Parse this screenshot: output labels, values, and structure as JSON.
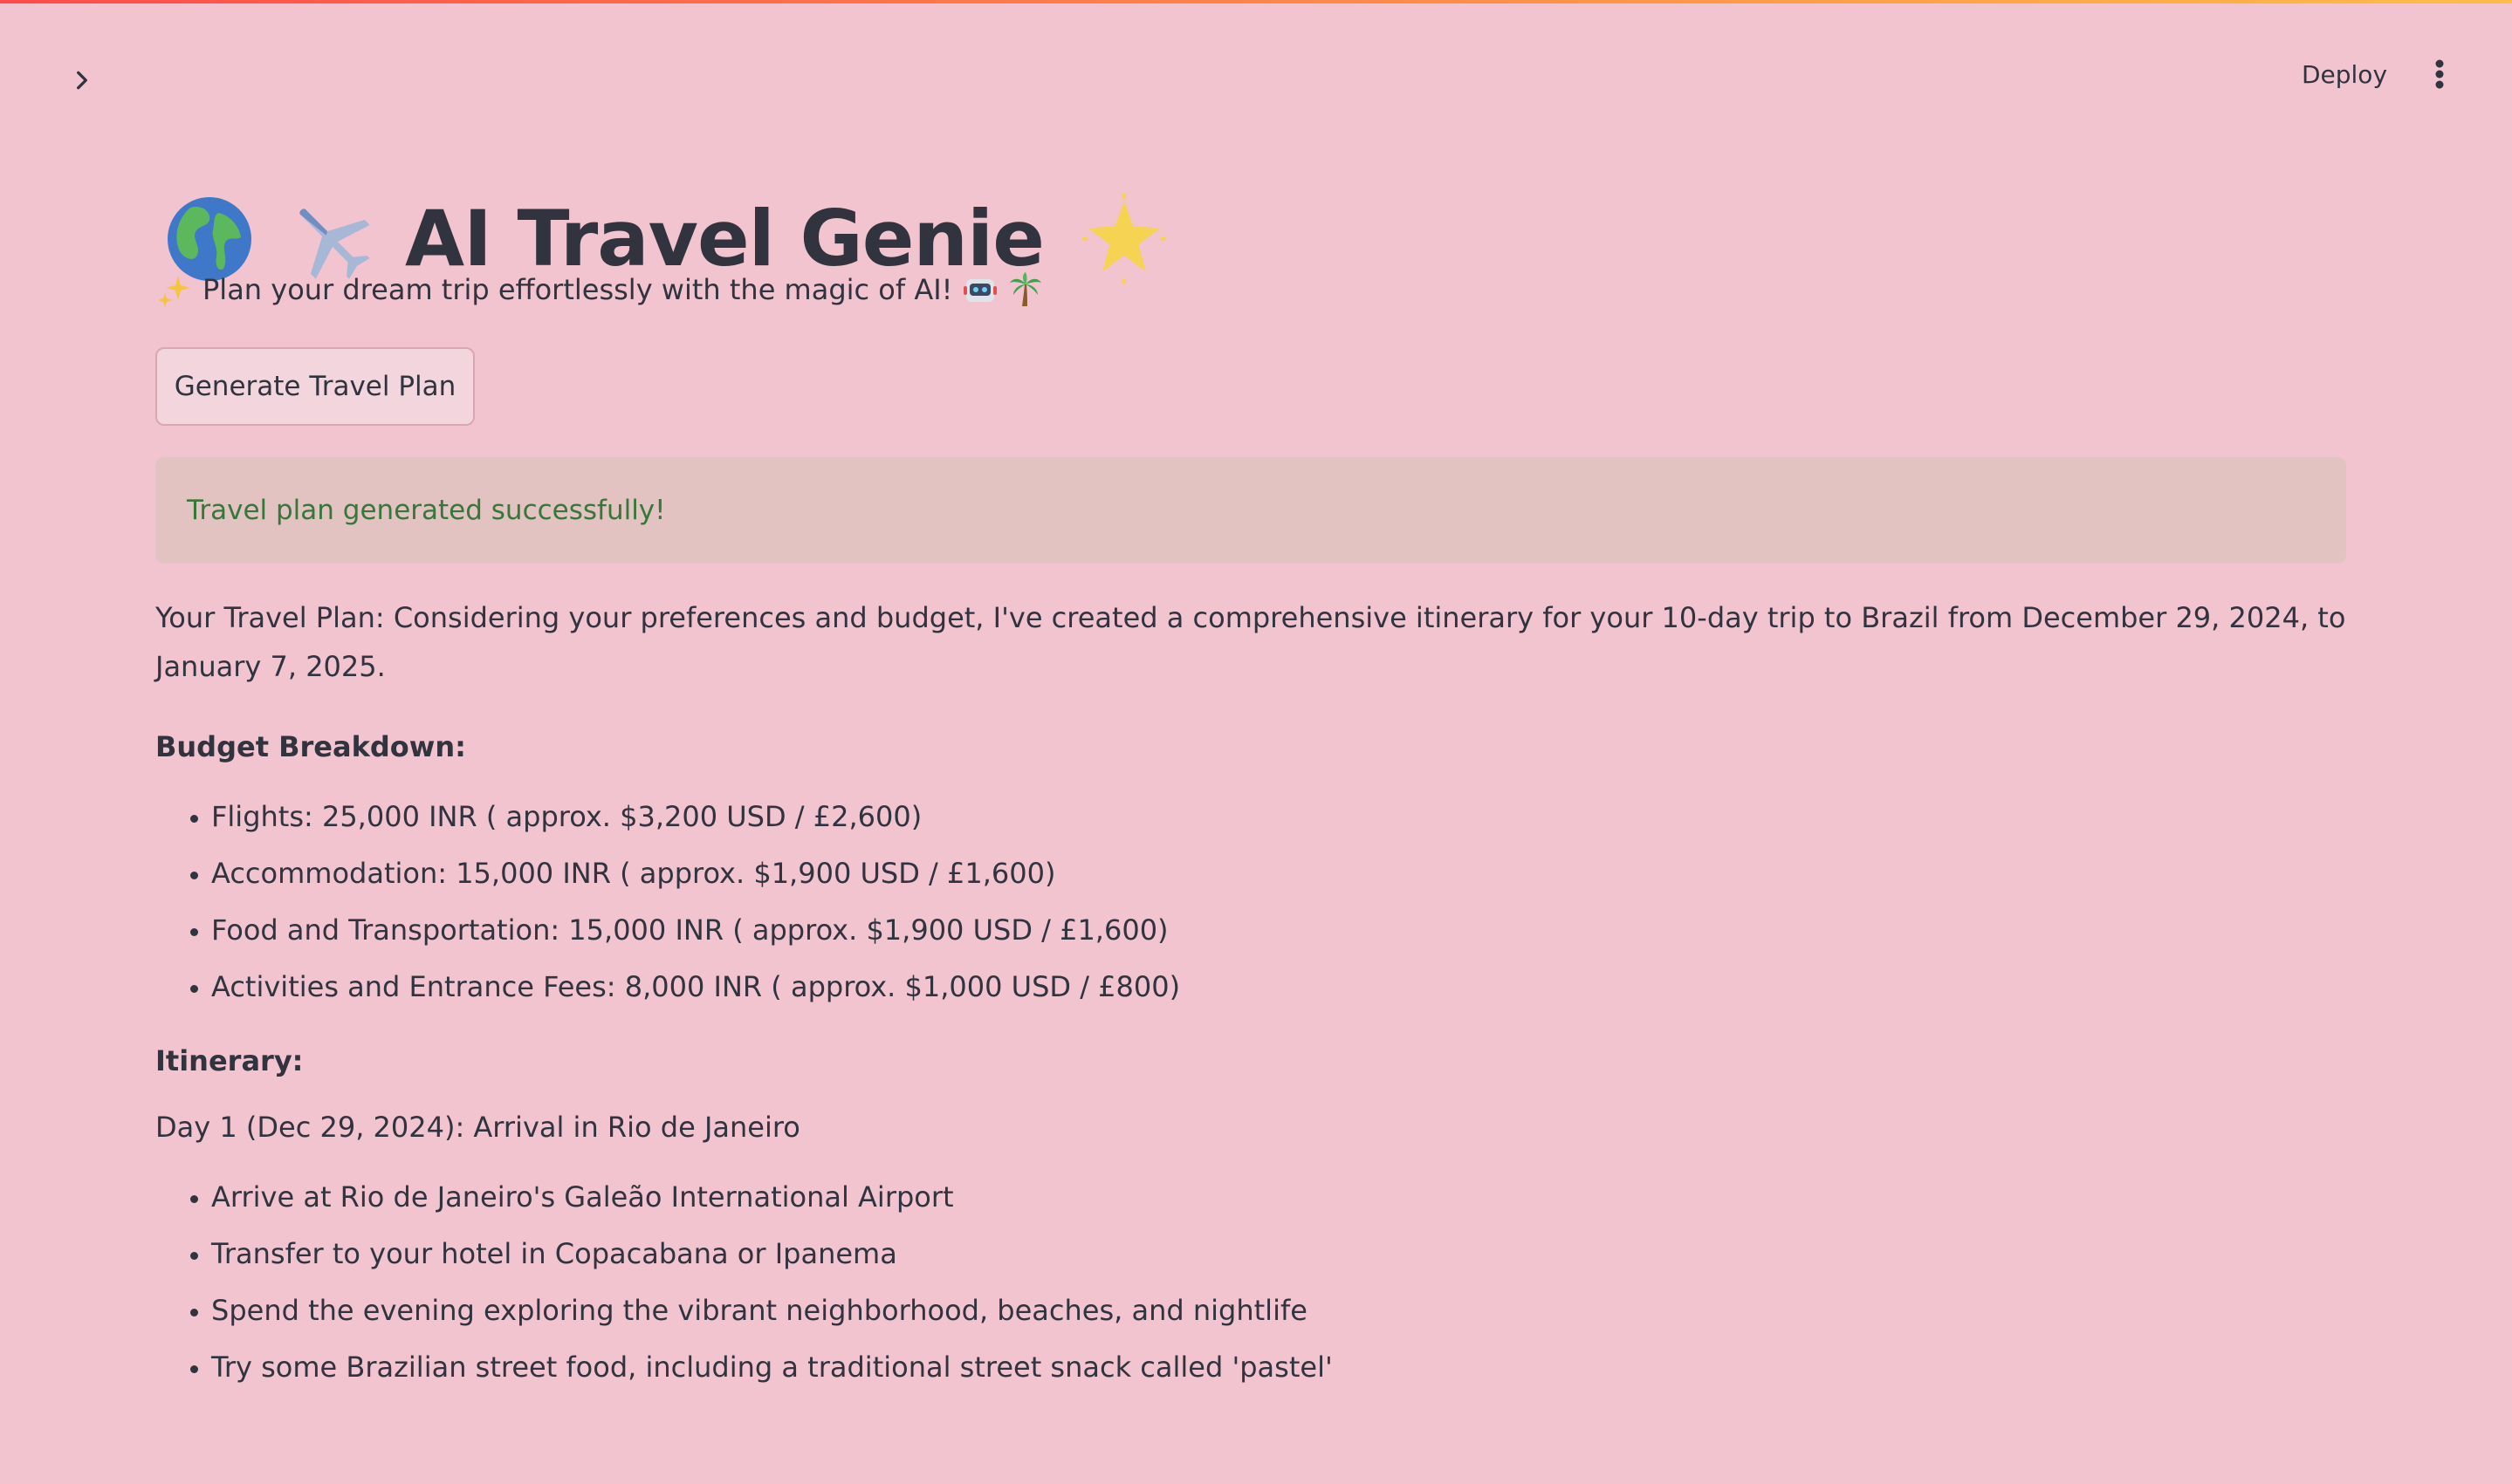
{
  "header": {
    "sidebar_toggle_icon": "chevron-right-icon",
    "deploy_label": "Deploy",
    "menu_icon": "vertical-ellipsis-icon"
  },
  "app": {
    "title_icons": [
      "globe-icon",
      "airplane-icon",
      "glowing-star-icon"
    ],
    "title": "AI Travel Genie",
    "subtitle_icons": [
      "sparkles-icon",
      "robot-icon",
      "palm-tree-icon"
    ],
    "subtitle": "Plan your dream trip effortlessly with the magic of AI!",
    "generate_button_label": "Generate Travel Plan",
    "success_message": "Travel plan generated successfully!"
  },
  "plan": {
    "intro": "Your Travel Plan: Considering your preferences and budget, I've created a comprehensive itinerary for your 10-day trip to Brazil from December 29, 2024, to January 7, 2025.",
    "budget_heading": "Budget Breakdown:",
    "budget_items": [
      "Flights: 25,000 INR ( approx. $3,200 USD / £2,600)",
      "Accommodation: 15,000 INR ( approx. $1,900 USD / £1,600)",
      "Food and Transportation: 15,000 INR ( approx. $1,900 USD / £1,600)",
      "Activities and Entrance Fees: 8,000 INR ( approx. $1,000 USD / £800)"
    ],
    "itinerary_heading": "Itinerary:",
    "day1_heading": "Day 1 (Dec 29, 2024): Arrival in Rio de Janeiro",
    "day1_items": [
      "Arrive at Rio de Janeiro's Galeão International Airport",
      "Transfer to your hotel in Copacabana or Ipanema",
      "Spend the evening exploring the vibrant neighborhood, beaches, and nightlife",
      "Try some Brazilian street food, including a traditional street snack called 'pastel'"
    ]
  },
  "colors": {
    "background": "#f1c4cf",
    "text": "#31333f",
    "success_text": "#37773a",
    "success_bg": "#e3c2c2",
    "top_bar_start": "#ff4b4b",
    "top_bar_end": "#ffbd45"
  }
}
